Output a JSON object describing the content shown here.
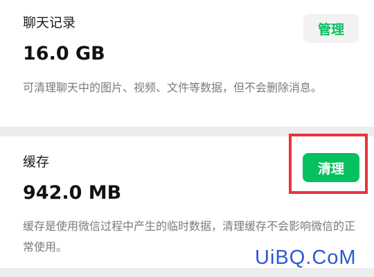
{
  "chat_history": {
    "title": "聊天记录",
    "size": "16.0 GB",
    "description": "可清理聊天中的图片、视频、文件等数据，但不会删除消息。",
    "manage_button": "管理"
  },
  "cache": {
    "title": "缓存",
    "size": "942.0 MB",
    "description": "缓存是使用微信过程中产生的临时数据，清理缓存不会影响微信的正常使用。",
    "clean_button": "清理"
  },
  "watermark": "UiBQ.CoM",
  "colors": {
    "accent_green": "#07c160",
    "highlight_red": "#e8333f",
    "watermark_blue": "#2b58d6"
  }
}
